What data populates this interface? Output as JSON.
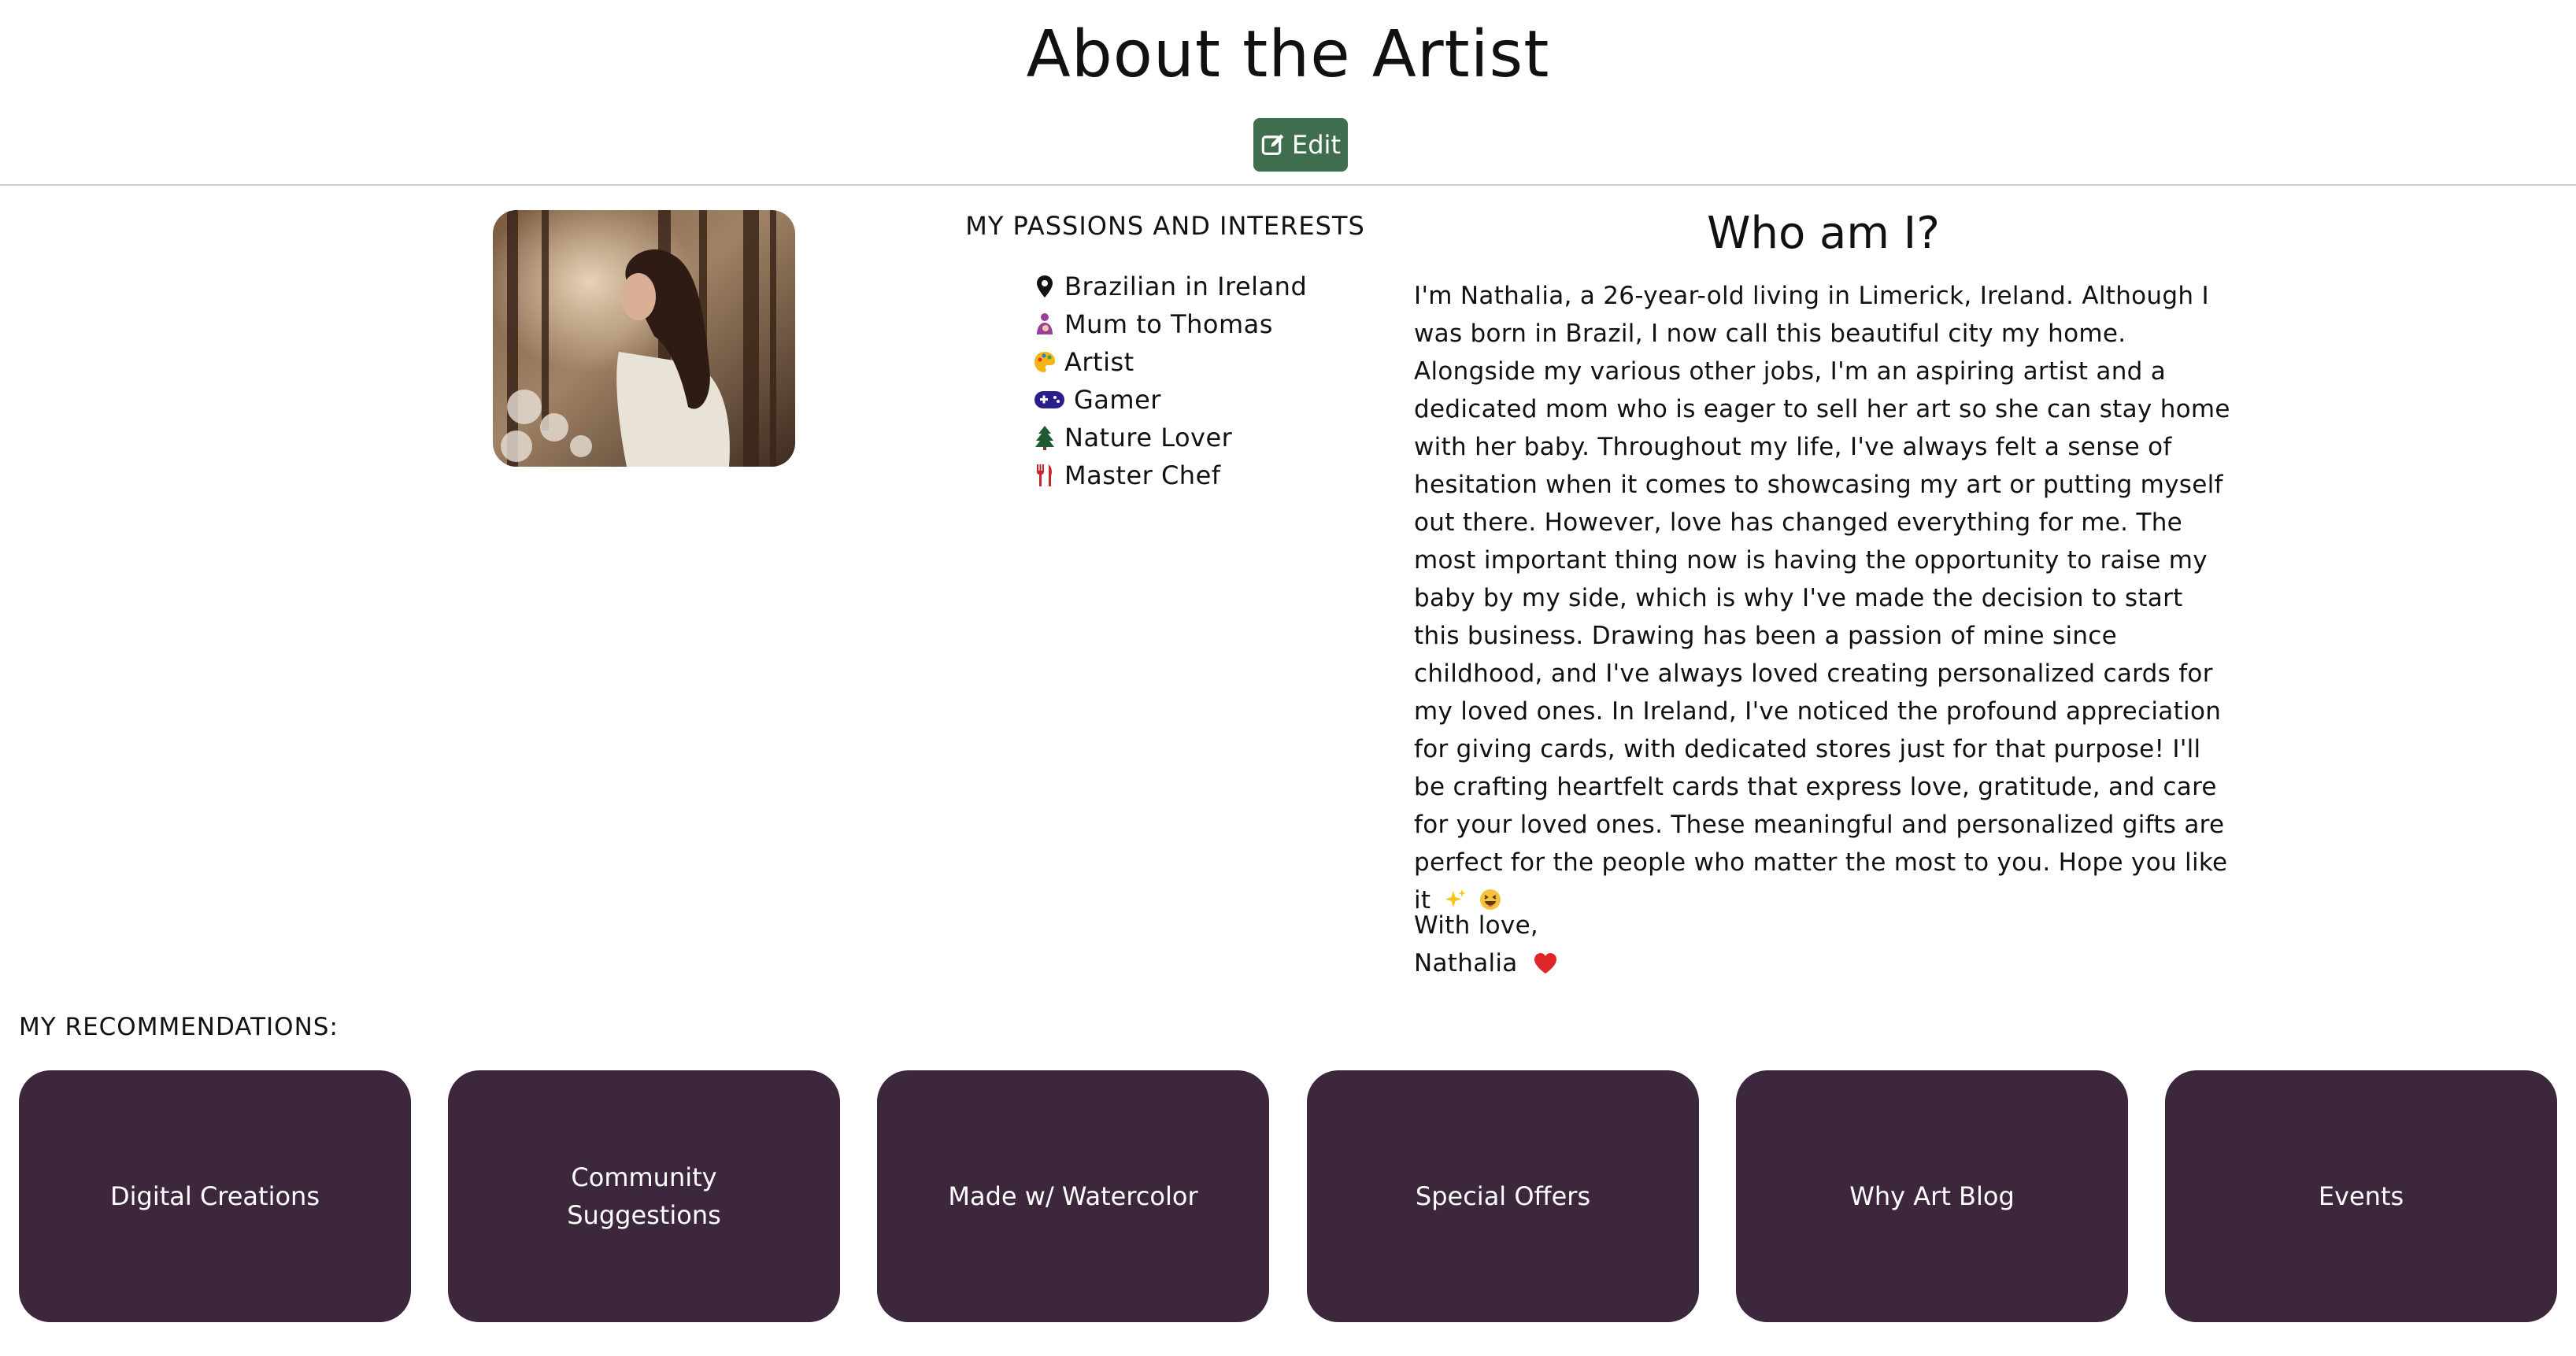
{
  "header": {
    "title": "About the Artist",
    "edit_label": "Edit",
    "edit_icon": "edit-icon",
    "edit_color": "#3f6e4f"
  },
  "profile": {
    "photo_alt": "Artist portrait in forest"
  },
  "passions": {
    "heading": "MY PASSIONS AND INTERESTS",
    "items": [
      {
        "icon": "map-pin-icon",
        "label": "Brazilian in Ireland"
      },
      {
        "icon": "breastfeeding-icon",
        "label": "Mum to Thomas"
      },
      {
        "icon": "palette-icon",
        "label": "Artist"
      },
      {
        "icon": "gamepad-icon",
        "label": "Gamer"
      },
      {
        "icon": "evergreen-tree-icon",
        "label": "Nature Lover"
      },
      {
        "icon": "fork-knife-icon",
        "label": "Master Chef"
      }
    ]
  },
  "about": {
    "heading": "Who am I?",
    "bio": "I'm Nathalia, a 26-year-old living in Limerick, Ireland. Although I was born in Brazil, I now call this beautiful city my home. Alongside my various other jobs, I'm an aspiring artist and a dedicated mom who is eager to sell her art so she can stay home with her baby. Throughout my life, I've always felt a sense of hesitation when it comes to showcasing my art or putting myself out there. However, love has changed everything for me. The most important thing now is having the opportunity to raise my baby by my side, which is why I've made the decision to start this business. Drawing has been a passion of mine since childhood, and I've always loved creating personalized cards for my loved ones. In Ireland, I've noticed the profound appreciation for giving cards, with dedicated stores just for that purpose! I'll be crafting heartfelt cards that express love, gratitude, and care for your loved ones. These meaningful and personalized gifts are perfect for the people who matter the most to you. Hope you like it",
    "bio_emojis": [
      "sparkles-icon",
      "grinning-squinting-face-icon"
    ],
    "signoff_line1": "With love,",
    "signoff_name": "Nathalia",
    "signoff_icon": "red-heart-icon"
  },
  "recommendations": {
    "heading": "MY RECOMMENDATIONS:",
    "card_color": "#3d273d",
    "items": [
      {
        "label": "Digital Creations"
      },
      {
        "label": "Community Suggestions"
      },
      {
        "label": "Made w/ Watercolor"
      },
      {
        "label": "Special Offers"
      },
      {
        "label": "Why Art Blog"
      },
      {
        "label": "Events"
      }
    ]
  }
}
